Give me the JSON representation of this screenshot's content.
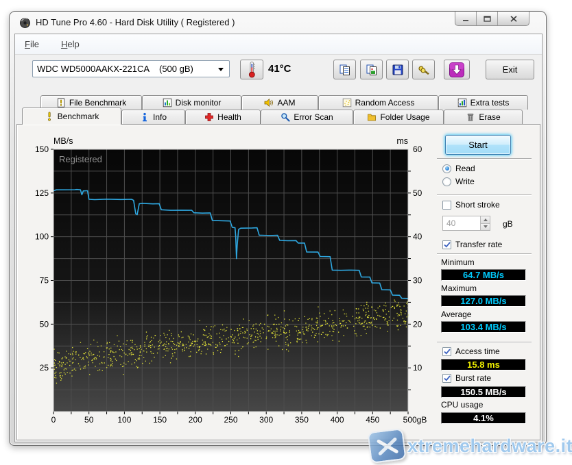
{
  "window": {
    "title": "HD Tune Pro 4.60 - Hard Disk Utility ( Registered )",
    "app_icon": "hard-disk-icon",
    "controls": [
      "minimize",
      "maximize",
      "close"
    ]
  },
  "menu": {
    "items": [
      {
        "key": "F",
        "rest": "ile"
      },
      {
        "key": "H",
        "rest": "elp"
      }
    ]
  },
  "toolbar": {
    "drive_model": "WDC WD5000AAKX-221CA",
    "drive_capacity": "(500 gB)",
    "temperature": "41°C",
    "temperature_icon": "thermometer-icon",
    "icon_buttons": [
      "copy-text-icon",
      "copy-image-icon",
      "save-icon",
      "serial-keys-icon",
      "download-icon"
    ],
    "exit_label": "Exit"
  },
  "tabs": {
    "row1": [
      {
        "label": "File Benchmark",
        "icon": "file-benchmark-icon"
      },
      {
        "label": "Disk monitor",
        "icon": "disk-monitor-icon"
      },
      {
        "label": "AAM",
        "icon": "speaker-icon"
      },
      {
        "label": "Random Access",
        "icon": "random-access-icon"
      },
      {
        "label": "Extra tests",
        "icon": "extra-tests-icon"
      }
    ],
    "row2": [
      {
        "label": "Benchmark",
        "icon": "exclamation-icon",
        "active": true
      },
      {
        "label": "Info",
        "icon": "info-icon"
      },
      {
        "label": "Health",
        "icon": "health-cross-icon"
      },
      {
        "label": "Error Scan",
        "icon": "magnifier-icon"
      },
      {
        "label": "Folder Usage",
        "icon": "folder-icon"
      },
      {
        "label": "Erase",
        "icon": "trash-icon"
      }
    ],
    "active_tab": "Benchmark"
  },
  "controls": {
    "start_label": "Start",
    "read_label": "Read",
    "read_checked": true,
    "write_label": "Write",
    "write_checked": false,
    "short_stroke_label": "Short stroke",
    "short_stroke_checked": false,
    "short_stroke_value": "40",
    "short_stroke_unit": "gB",
    "transfer_rate_label": "Transfer rate",
    "transfer_rate_checked": true,
    "minimum_label": "Minimum",
    "minimum_value": "64.7 MB/s",
    "maximum_label": "Maximum",
    "maximum_value": "127.0 MB/s",
    "average_label": "Average",
    "average_value": "103.4 MB/s",
    "access_time_label": "Access time",
    "access_time_checked": true,
    "access_time_value": "15.8 ms",
    "burst_rate_label": "Burst rate",
    "burst_rate_checked": true,
    "burst_rate_value": "150.5 MB/s",
    "cpu_usage_label": "CPU usage",
    "cpu_usage_value": "4.1%",
    "value_colors": {
      "speed": "#00ccff",
      "access": "#f0f000",
      "plain": "#ffffff"
    }
  },
  "chart_data": {
    "type": "line+scatter",
    "registered_watermark": "Registered",
    "grid": true,
    "x_axis": {
      "min": 0,
      "max": 500,
      "unit": "gB",
      "major_tick": 50,
      "minor_tick": 25
    },
    "y_left": {
      "label": "MB/s",
      "min": 0,
      "max": 150,
      "labeled_ticks": [
        150,
        125,
        100,
        75,
        50,
        25
      ],
      "grid_step": 12.5
    },
    "y_right": {
      "label": "ms",
      "min": 0,
      "max": 60,
      "labeled_ticks": [
        60,
        50,
        40,
        30,
        20,
        10
      ],
      "tick_step": 5
    },
    "series": [
      {
        "name": "Transfer rate",
        "type": "line",
        "unit": "MB/s",
        "color": "#2fa8e1",
        "points": [
          [
            0,
            126.3
          ],
          [
            4,
            126.8
          ],
          [
            30,
            126.9
          ],
          [
            33,
            127.0
          ],
          [
            38,
            126.8
          ],
          [
            40,
            124.0
          ],
          [
            42,
            126.2
          ],
          [
            48,
            126.3
          ],
          [
            50,
            121.4
          ],
          [
            58,
            121.2
          ],
          [
            75,
            121.5
          ],
          [
            95,
            121.3
          ],
          [
            110,
            121.4
          ],
          [
            113,
            120.8
          ],
          [
            116,
            113.2
          ],
          [
            118,
            112.6
          ],
          [
            121,
            118.9
          ],
          [
            126,
            119.1
          ],
          [
            140,
            118.8
          ],
          [
            149,
            118.9
          ],
          [
            152,
            115.4
          ],
          [
            165,
            115.1
          ],
          [
            180,
            115.2
          ],
          [
            195,
            115.1
          ],
          [
            198,
            113.7
          ],
          [
            210,
            113.5
          ],
          [
            221,
            113.6
          ],
          [
            224,
            109.3
          ],
          [
            240,
            109.1
          ],
          [
            249,
            109.0
          ],
          [
            252,
            105.4
          ],
          [
            256,
            105.1
          ],
          [
            257,
            100.0
          ],
          [
            258,
            87.5
          ],
          [
            259,
            95.0
          ],
          [
            261,
            104.2
          ],
          [
            264,
            104.9
          ],
          [
            280,
            105.0
          ],
          [
            287,
            105.1
          ],
          [
            290,
            100.9
          ],
          [
            305,
            100.7
          ],
          [
            316,
            100.8
          ],
          [
            319,
            97.9
          ],
          [
            330,
            97.7
          ],
          [
            342,
            97.8
          ],
          [
            345,
            96.4
          ],
          [
            354,
            96.4
          ],
          [
            357,
            91.3
          ],
          [
            373,
            91.2
          ],
          [
            376,
            88.7
          ],
          [
            390,
            88.6
          ],
          [
            393,
            80.9
          ],
          [
            405,
            80.8
          ],
          [
            420,
            80.9
          ],
          [
            431,
            80.8
          ],
          [
            434,
            77.0
          ],
          [
            446,
            76.9
          ],
          [
            449,
            73.6
          ],
          [
            460,
            73.5
          ],
          [
            463,
            69.7
          ],
          [
            475,
            69.6
          ],
          [
            478,
            66.6
          ],
          [
            488,
            66.5
          ],
          [
            491,
            64.8
          ],
          [
            500,
            64.7
          ]
        ]
      },
      {
        "name": "Access time",
        "type": "scatter",
        "unit": "ms",
        "color": "#e8e838",
        "approximation": {
          "seed": 1337,
          "count": 880,
          "spread": 3.0,
          "min_ms": 3.5,
          "max_ms": 29.5,
          "trend": [
            [
              0,
              10.0
            ],
            [
              30,
              12.0
            ],
            [
              60,
              12.5
            ],
            [
              100,
              13.2
            ],
            [
              150,
              14.8
            ],
            [
              200,
              15.8
            ],
            [
              250,
              16.8
            ],
            [
              300,
              17.8
            ],
            [
              350,
              18.8
            ],
            [
              400,
              20.0
            ],
            [
              450,
              21.5
            ],
            [
              500,
              22.5
            ]
          ]
        }
      }
    ]
  },
  "watermark": {
    "text": "xtremehardware.it",
    "logo": "x-logo-icon",
    "color": "#96c3eb"
  }
}
